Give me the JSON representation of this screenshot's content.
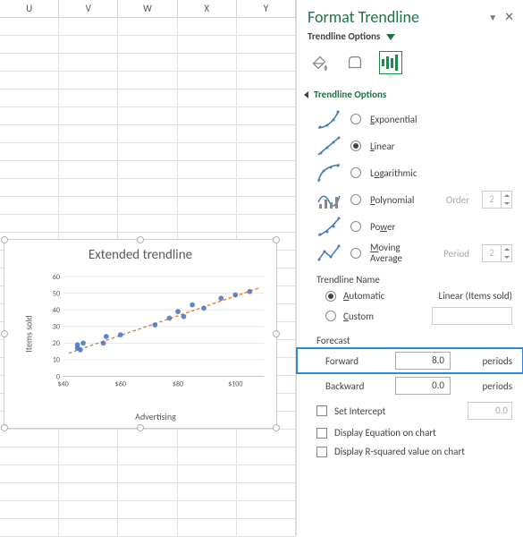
{
  "columns": [
    "U",
    "V",
    "W",
    "X",
    "Y"
  ],
  "chart": {
    "title": "Extended trendline",
    "xlabel": "Advertising",
    "ylabel": "Items sold"
  },
  "chart_data": {
    "type": "scatter",
    "x": [
      45,
      45,
      46,
      47,
      54,
      55,
      60,
      72,
      77,
      80,
      82,
      85,
      89,
      95,
      100,
      105
    ],
    "y": [
      17,
      19,
      16,
      20,
      20,
      24,
      25,
      31,
      35,
      39,
      36,
      43,
      41,
      47,
      49,
      51
    ],
    "trendline": {
      "x1": 42,
      "y1": 14,
      "x2": 108,
      "y2": 53
    },
    "xlim": [
      40,
      110
    ],
    "ylim": [
      0,
      60
    ],
    "xticks": [
      "$40",
      "$60",
      "$80",
      "$100"
    ],
    "yticks": [
      0,
      10,
      20,
      30,
      40,
      50,
      60
    ],
    "title": "Extended trendline",
    "xlabel": "Advertising",
    "ylabel": "Items sold"
  },
  "pane": {
    "title": "Format Trendline",
    "subtitle": "Trendline Options",
    "section": "Trendline Options",
    "types": {
      "exponential": "Exponential",
      "linear": "Linear",
      "logarithmic": "Logarithmic",
      "polynomial": "Polynomial",
      "power": "Power",
      "moving1": "Moving",
      "moving2": "Average",
      "order_label": "Order",
      "order_val": "2",
      "period_label": "Period",
      "period_val": "2"
    },
    "name_section": "Trendline Name",
    "auto_label": "Automatic",
    "auto_value": "Linear (Items sold)",
    "custom_label": "Custom",
    "custom_value": "",
    "forecast_section": "Forecast",
    "forward_label": "Forward",
    "forward_value": "8.0",
    "backward_label": "Backward",
    "backward_value": "0.0",
    "periods_label": "periods",
    "set_intercept": "Set Intercept",
    "set_intercept_val": "0.0",
    "disp_eq": "Display Equation on chart",
    "disp_r2": "Display R-squared value on chart"
  }
}
